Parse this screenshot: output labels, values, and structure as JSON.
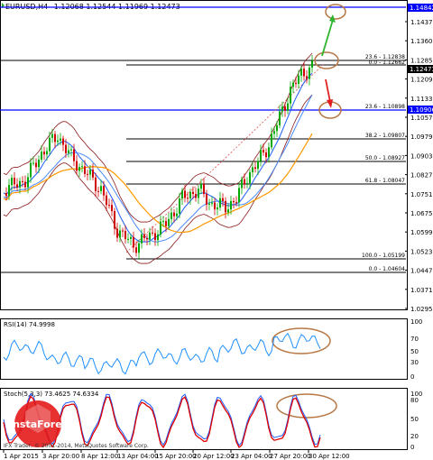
{
  "header": {
    "symbol": "EURUSD,H4",
    "ohlc": "1.12068 1.12544 1.11969 1.12473"
  },
  "price_axis": {
    "ticks": [
      "1.14370",
      "1.13600",
      "1.12850",
      "1.12090",
      "1.11330",
      "1.10570",
      "1.09790",
      "1.09030",
      "1.08270",
      "1.07510",
      "1.06750",
      "1.05990",
      "1.05230",
      "1.04470",
      "1.03710",
      "1.02950"
    ],
    "tag_top": "1.14842",
    "tag_current": "1.12473",
    "tag_level": "1.10906"
  },
  "fibo_labels": [
    {
      "text": "23.6 - 1.12838"
    },
    {
      "text": "0.0 - 1.12662"
    },
    {
      "text": "23.6 - 1.10898"
    },
    {
      "text": "38.2 - 1.09807"
    },
    {
      "text": "50.0 - 1.08927"
    },
    {
      "text": "61.8 - 1.08047"
    },
    {
      "text": "100.0 - 1.05199"
    },
    {
      "text": "0.0 - 1.04604"
    }
  ],
  "rsi": {
    "label": "RSI(14) 74.9998",
    "ticks": [
      "100",
      "70",
      "50",
      "30",
      "0"
    ]
  },
  "stoch": {
    "label": "Stoch(5,3,3) 73.4625 74.6334",
    "ticks": [
      "100",
      "80",
      "50",
      "20",
      "0"
    ]
  },
  "time_axis": [
    "1 Apr 2015",
    "3 Apr 20:00",
    "8 Apr 12:00",
    "13 Apr 04:00",
    "15 Apr 20:00",
    "20 Apr 12:00",
    "23 Apr 04:00",
    "27 Apr 20:00",
    "30 Apr 12:00"
  ],
  "watermark": {
    "brand": "InstaForex",
    "copyright": "IFX Trader, © 2001-2014, MetaQuotes Software Corp."
  },
  "colors": {
    "bull": "#00a800",
    "bear": "#d00000",
    "support_line": "#0000ff",
    "bands": "#8b1a1a",
    "ma_blue": "#1e5cff",
    "ma_orange": "#ff9900",
    "circle": "#b87845",
    "arrow_up": "#2db52d",
    "arrow_down": "#e02020"
  }
}
